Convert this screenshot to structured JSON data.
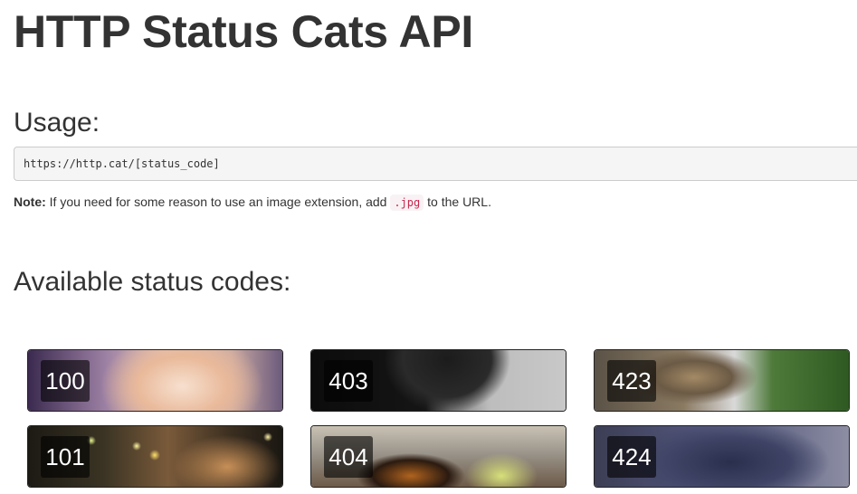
{
  "page": {
    "title": "HTTP Status Cats API"
  },
  "usage": {
    "heading": "Usage:",
    "url_template": "https://http.cat/[status_code]"
  },
  "note": {
    "label": "Note:",
    "text_before": " If you need for some reason to use an image extension, add ",
    "code": ".jpg",
    "text_after": " to the URL."
  },
  "available": {
    "heading": "Available status codes:"
  },
  "status_codes": [
    {
      "code": "100"
    },
    {
      "code": "403"
    },
    {
      "code": "423"
    },
    {
      "code": "101"
    },
    {
      "code": "404"
    },
    {
      "code": "424"
    }
  ]
}
